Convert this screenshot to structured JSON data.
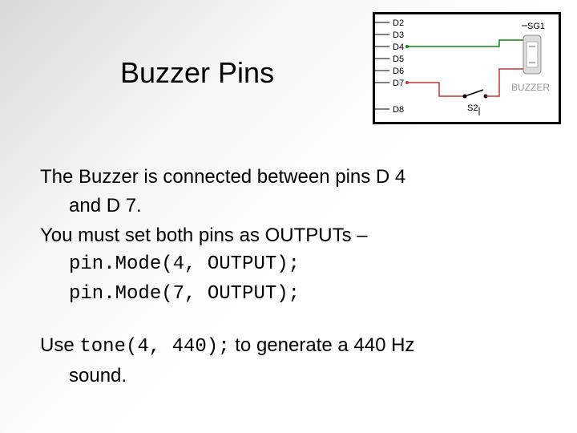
{
  "title": "Buzzer Pins",
  "diagram": {
    "pins": [
      "D2",
      "D3",
      "D4",
      "D5",
      "D6",
      "D7",
      "D8"
    ],
    "sg_label": "SG1",
    "buzzer_label": "BUZZER",
    "switch_label": "S2"
  },
  "para1": {
    "line1": "The Buzzer is connected between pins D 4",
    "line2": "and D 7."
  },
  "para2": {
    "line1": "You must set both pins as OUTPUTs –",
    "code1": "pin.Mode(4, OUTPUT);",
    "code2": "pin.Mode(7, OUTPUT);"
  },
  "para3": {
    "pre": "Use ",
    "code": "tone(4, 440);",
    "post": " to generate a 440 Hz",
    "line2": "sound."
  }
}
